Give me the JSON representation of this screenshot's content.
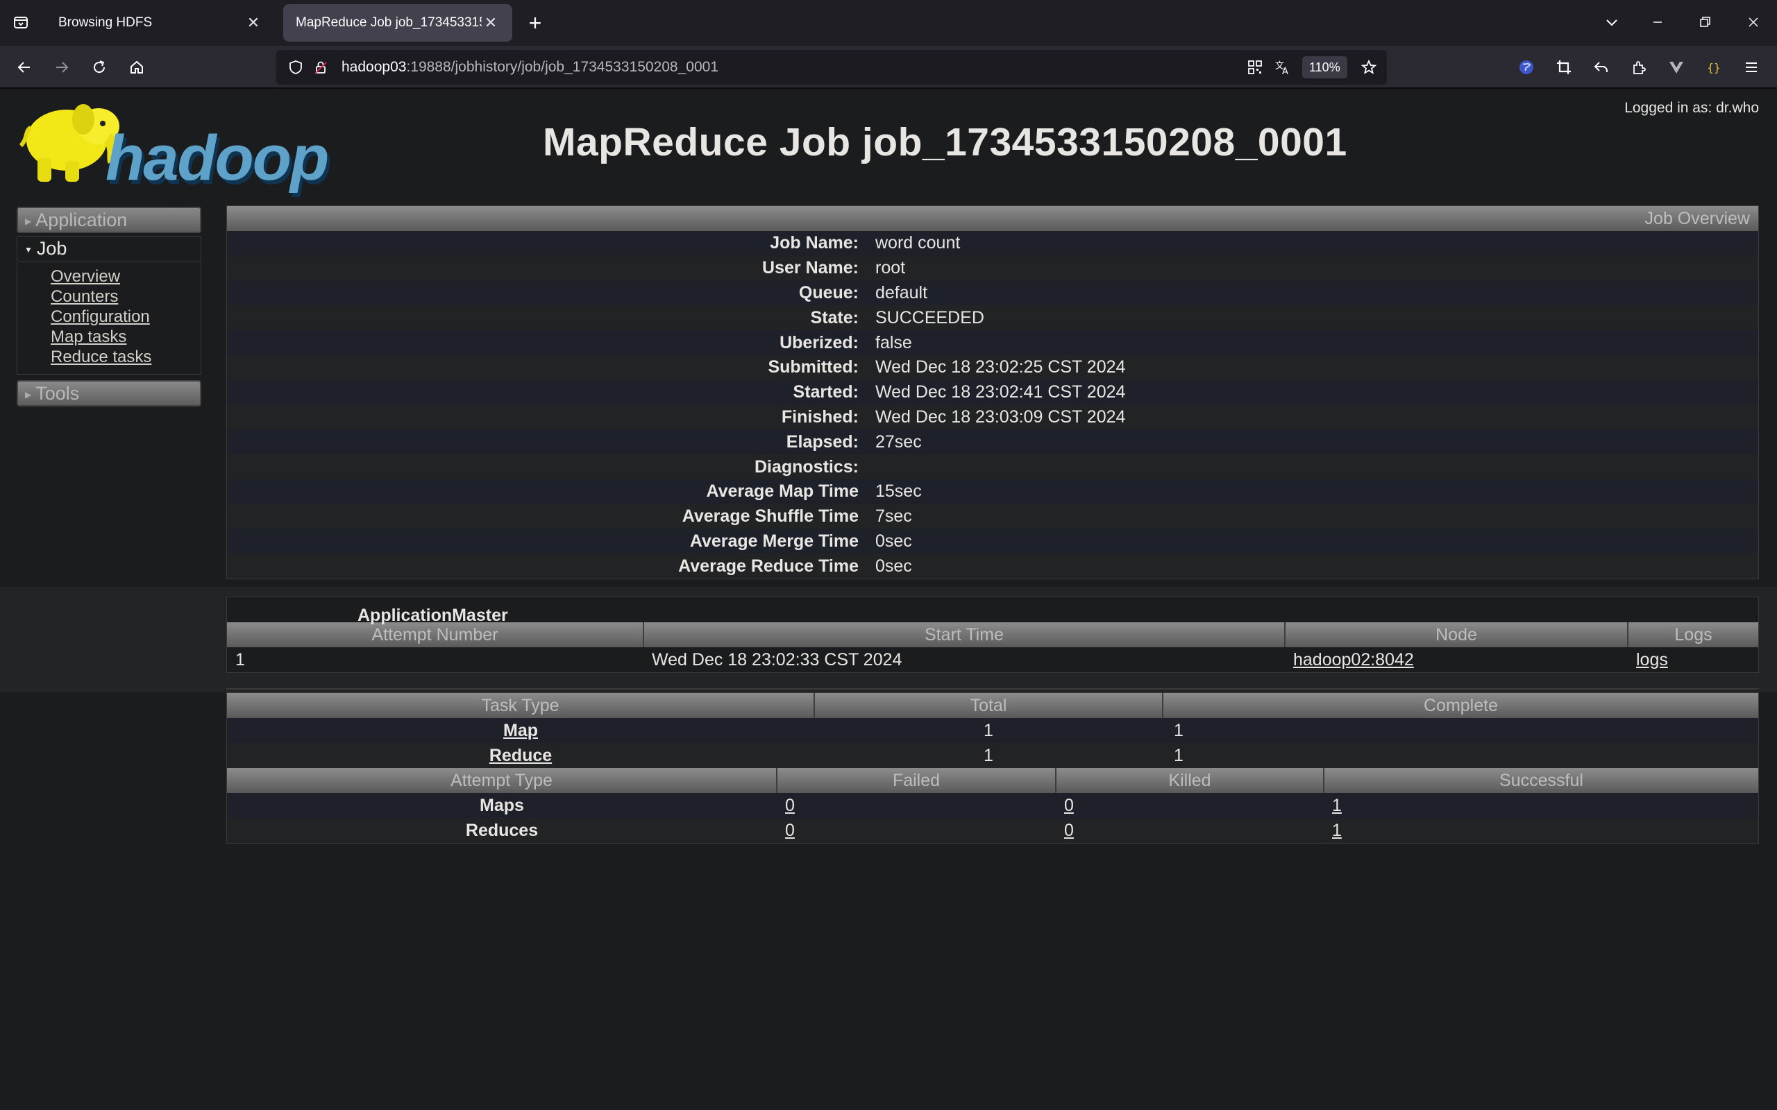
{
  "browser": {
    "tabs": [
      {
        "title": "Browsing HDFS",
        "active": false
      },
      {
        "title": "MapReduce Job job_1734533150208_0001",
        "active": true
      }
    ],
    "url_host": "hadoop03",
    "url_rest": ":19888/jobhistory/job/job_1734533150208_0001",
    "zoom": "110%"
  },
  "header": {
    "logo_text": "hadoop",
    "logged_in": "Logged in as: dr.who",
    "title": "MapReduce Job job_1734533150208_0001"
  },
  "sidebar": {
    "application": "Application",
    "job": "Job",
    "job_links": [
      "Overview",
      "Counters",
      "Configuration",
      "Map tasks",
      "Reduce tasks"
    ],
    "tools": "Tools"
  },
  "overview": {
    "header": "Job Overview",
    "rows": [
      {
        "label": "Job Name:",
        "value": "word count"
      },
      {
        "label": "User Name:",
        "value": "root"
      },
      {
        "label": "Queue:",
        "value": "default"
      },
      {
        "label": "State:",
        "value": "SUCCEEDED"
      },
      {
        "label": "Uberized:",
        "value": "false"
      },
      {
        "label": "Submitted:",
        "value": "Wed Dec 18 23:02:25 CST 2024"
      },
      {
        "label": "Started:",
        "value": "Wed Dec 18 23:02:41 CST 2024"
      },
      {
        "label": "Finished:",
        "value": "Wed Dec 18 23:03:09 CST 2024"
      },
      {
        "label": "Elapsed:",
        "value": "27sec"
      },
      {
        "label": "Diagnostics:",
        "value": ""
      },
      {
        "label": "Average Map Time",
        "value": "15sec"
      },
      {
        "label": "Average Shuffle Time",
        "value": "7sec"
      },
      {
        "label": "Average Merge Time",
        "value": "0sec"
      },
      {
        "label": "Average Reduce Time",
        "value": "0sec"
      }
    ]
  },
  "app_master": {
    "title": "ApplicationMaster",
    "columns": [
      "Attempt Number",
      "Start Time",
      "Node",
      "Logs"
    ],
    "row": {
      "attempt": "1",
      "start": "Wed Dec 18 23:02:33 CST 2024",
      "node": "hadoop02:8042",
      "logs": "logs"
    }
  },
  "tasks": {
    "columns": [
      "Task Type",
      "Total",
      "Complete"
    ],
    "rows": [
      {
        "type": "Map",
        "total": "1",
        "complete": "1"
      },
      {
        "type": "Reduce",
        "total": "1",
        "complete": "1"
      }
    ]
  },
  "attempts": {
    "columns": [
      "Attempt Type",
      "Failed",
      "Killed",
      "Successful"
    ],
    "rows": [
      {
        "type": "Maps",
        "failed": "0",
        "killed": "0",
        "successful": "1"
      },
      {
        "type": "Reduces",
        "failed": "0",
        "killed": "0",
        "successful": "1"
      }
    ]
  }
}
